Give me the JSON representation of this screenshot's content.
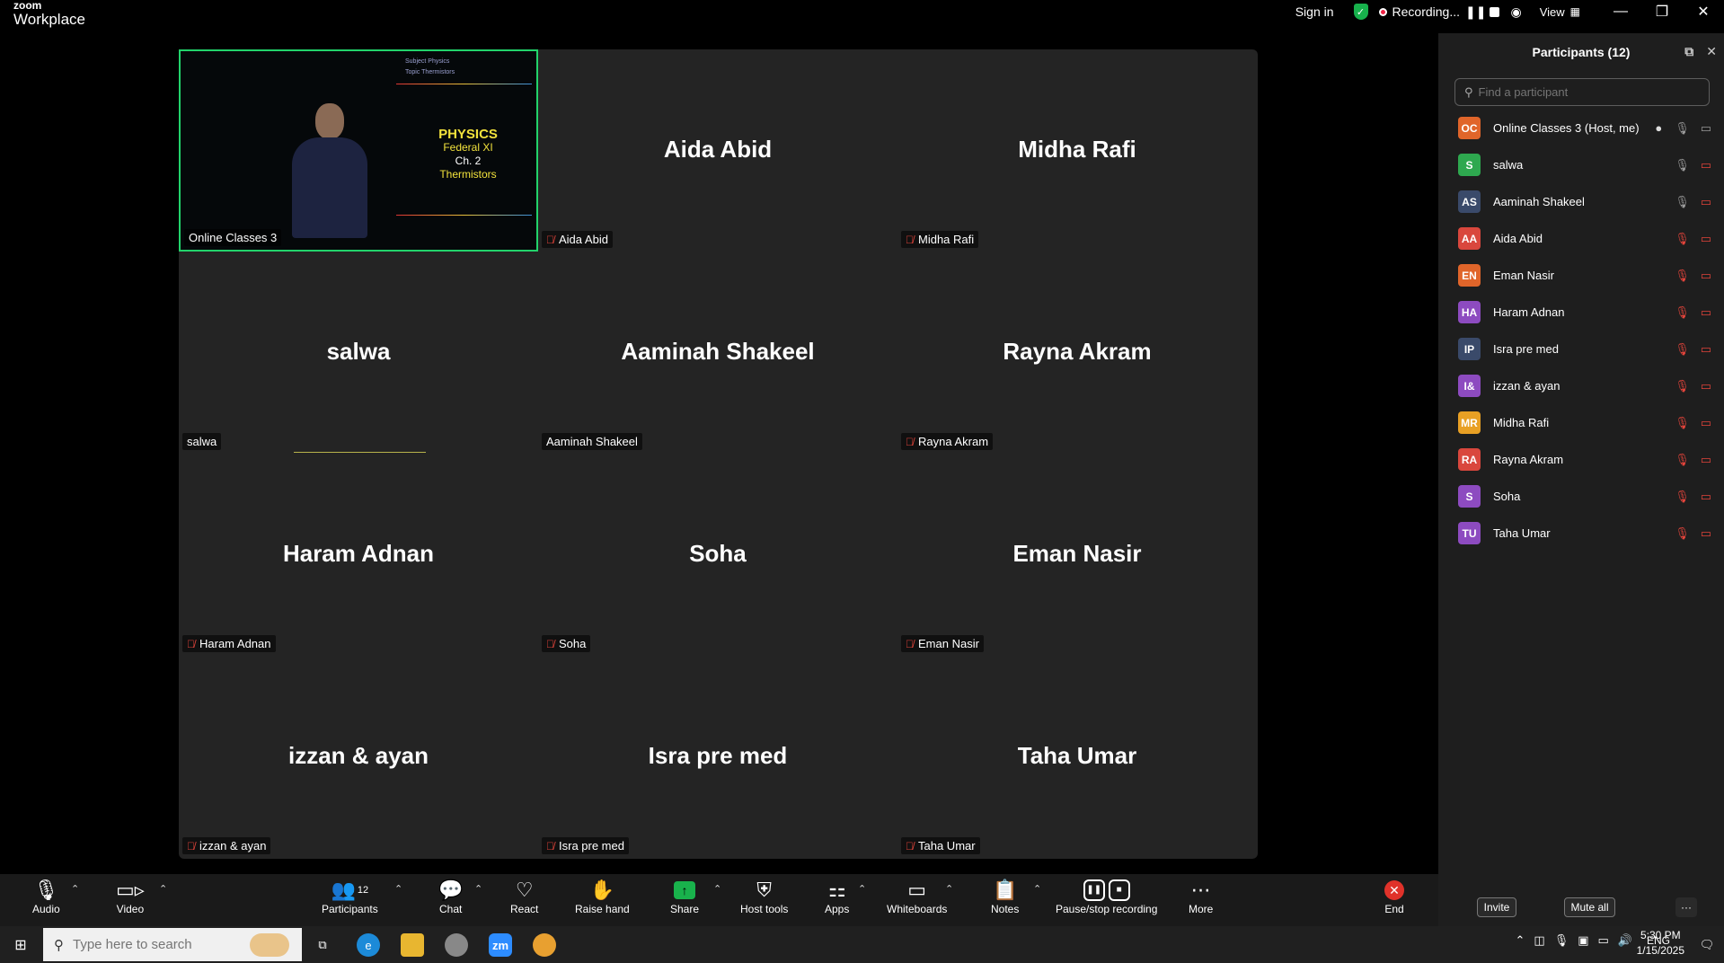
{
  "app": {
    "brand_top": "zoom",
    "brand_bottom": "Workplace"
  },
  "titlebar": {
    "sign_in": "Sign in",
    "recording": "Recording...",
    "view": "View",
    "minimize": "—",
    "restore": "❐",
    "close": "✕"
  },
  "gallery": {
    "active_tile": {
      "label": "Online Classes 3",
      "slide_top": [
        "Subject   Physics",
        "Topic     Thermistors"
      ],
      "slide_lines": [
        "PHYSICS",
        "Federal XI",
        "Ch. 2",
        "Thermistors"
      ]
    },
    "tiles": [
      {
        "big": "Aida Abid",
        "label": "Aida Abid",
        "muted": true
      },
      {
        "big": "Midha Rafi",
        "label": "Midha Rafi",
        "muted": true
      },
      {
        "big": "salwa",
        "label": "salwa",
        "muted": false
      },
      {
        "big": "Aaminah Shakeel",
        "label": "Aaminah Shakeel",
        "muted": false
      },
      {
        "big": "Rayna Akram",
        "label": "Rayna Akram",
        "muted": true
      },
      {
        "big": "Haram Adnan",
        "label": "Haram Adnan",
        "muted": true
      },
      {
        "big": "Soha",
        "label": "Soha",
        "muted": true
      },
      {
        "big": "Eman Nasir",
        "label": "Eman Nasir",
        "muted": true
      },
      {
        "big": "izzan & ayan",
        "label": "izzan & ayan",
        "muted": true
      },
      {
        "big": "Isra pre med",
        "label": "Isra pre med",
        "muted": true
      },
      {
        "big": "Taha Umar",
        "label": "Taha Umar",
        "muted": true
      }
    ]
  },
  "panel": {
    "title": "Participants (12)",
    "search_placeholder": "Find a participant",
    "participants": [
      {
        "initials": "OC",
        "name": "Online Classes 3 (Host, me)",
        "color": "#e0652a",
        "mic": "on",
        "cam": "on"
      },
      {
        "initials": "S",
        "name": "salwa",
        "color": "#2ea84f",
        "mic": "on",
        "cam": "off"
      },
      {
        "initials": "AS",
        "name": "Aaminah Shakeel",
        "color": "#3a4a6a",
        "mic": "on",
        "cam": "off"
      },
      {
        "initials": "AA",
        "name": "Aida Abid",
        "color": "#d9473d",
        "mic": "off",
        "cam": "off"
      },
      {
        "initials": "EN",
        "name": "Eman Nasir",
        "color": "#e0652a",
        "mic": "off",
        "cam": "off"
      },
      {
        "initials": "HA",
        "name": "Haram Adnan",
        "color": "#8d4bc0",
        "mic": "off",
        "cam": "off"
      },
      {
        "initials": "IP",
        "name": "Isra pre med",
        "color": "#3a4a6a",
        "mic": "off",
        "cam": "off"
      },
      {
        "initials": "I&",
        "name": "izzan & ayan",
        "color": "#8d4bc0",
        "mic": "off",
        "cam": "off"
      },
      {
        "initials": "MR",
        "name": "Midha Rafi",
        "color": "#e8a024",
        "mic": "off",
        "cam": "off"
      },
      {
        "initials": "RA",
        "name": "Rayna Akram",
        "color": "#d9473d",
        "mic": "off",
        "cam": "off"
      },
      {
        "initials": "S",
        "name": "Soha",
        "color": "#8d4bc0",
        "mic": "off",
        "cam": "off"
      },
      {
        "initials": "TU",
        "name": "Taha Umar",
        "color": "#8d4bc0",
        "mic": "off",
        "cam": "off"
      }
    ],
    "invite": "Invite",
    "mute_all": "Mute all",
    "more": "···"
  },
  "toolbar": {
    "audio": "Audio",
    "video": "Video",
    "participants": "Participants",
    "participants_count": "12",
    "chat": "Chat",
    "react": "React",
    "raise_hand": "Raise hand",
    "share": "Share",
    "host_tools": "Host tools",
    "apps": "Apps",
    "whiteboards": "Whiteboards",
    "notes": "Notes",
    "pause_stop": "Pause/stop recording",
    "more": "More",
    "end": "End"
  },
  "taskbar": {
    "search_placeholder": "Type here to search",
    "lang": "ENG",
    "time": "5:30 PM",
    "date": "1/15/2025"
  }
}
